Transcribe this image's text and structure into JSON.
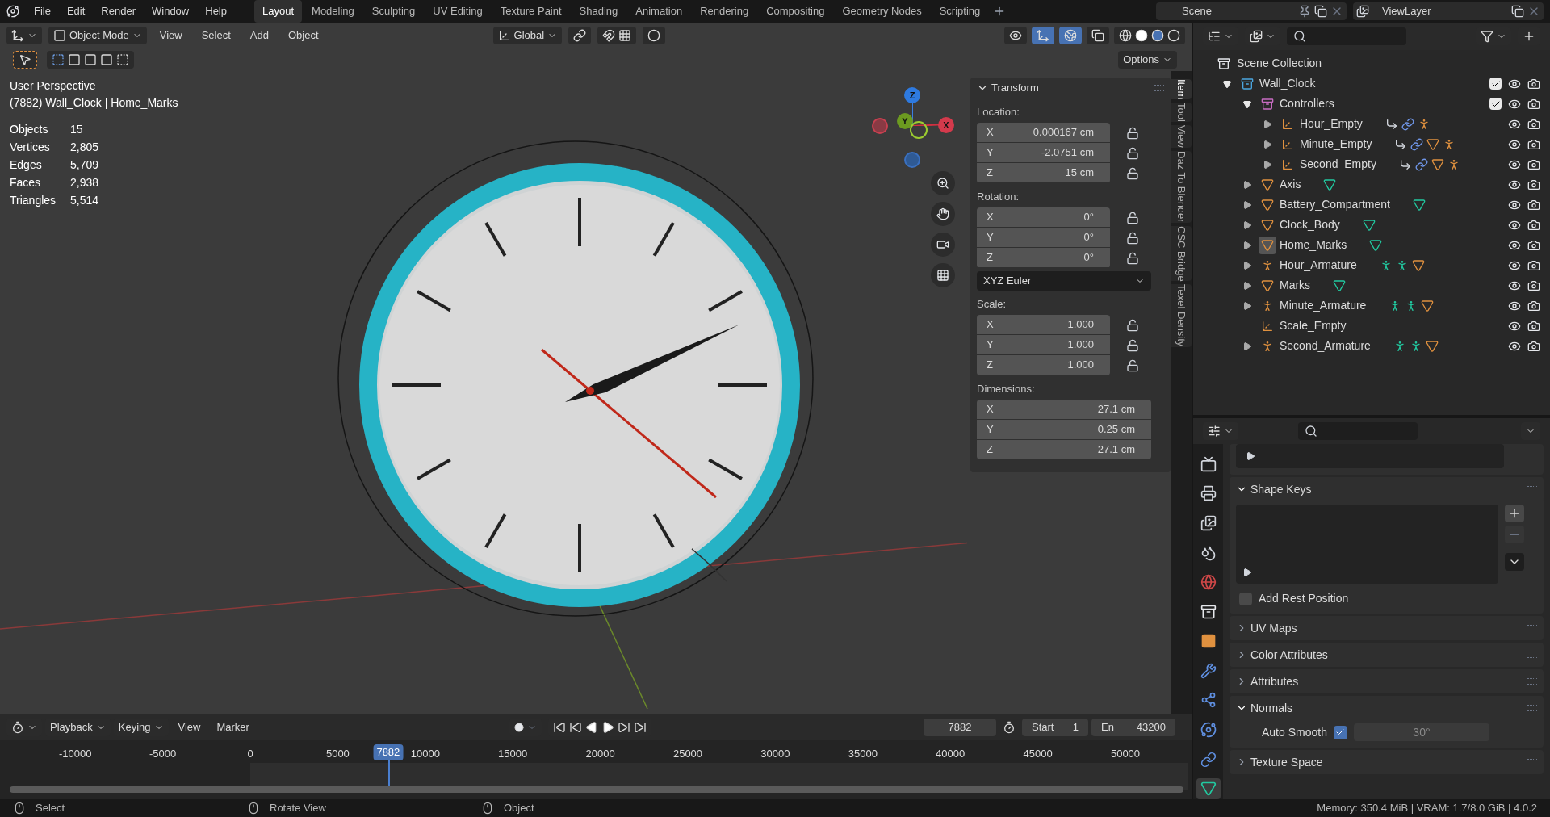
{
  "menu": [
    "File",
    "Edit",
    "Render",
    "Window",
    "Help"
  ],
  "workspaces": [
    {
      "label": "Layout",
      "selected": true
    },
    {
      "label": "Modeling",
      "selected": false
    },
    {
      "label": "Sculpting",
      "selected": false
    },
    {
      "label": "UV Editing",
      "selected": false
    },
    {
      "label": "Texture Paint",
      "selected": false
    },
    {
      "label": "Shading",
      "selected": false
    },
    {
      "label": "Animation",
      "selected": false
    },
    {
      "label": "Rendering",
      "selected": false
    },
    {
      "label": "Compositing",
      "selected": false
    },
    {
      "label": "Geometry Nodes",
      "selected": false
    },
    {
      "label": "Scripting",
      "selected": false
    }
  ],
  "scene": "Scene",
  "view_layer": "ViewLayer",
  "viewport": {
    "mode": "Object Mode",
    "menus": [
      "View",
      "Select",
      "Add",
      "Object"
    ],
    "orientation": "Global",
    "options": "Options",
    "title": "User Perspective",
    "context": "(7882) Wall_Clock | Home_Marks",
    "stats": [
      {
        "label": "Objects",
        "value": "15"
      },
      {
        "label": "Vertices",
        "value": "2,805"
      },
      {
        "label": "Edges",
        "value": "5,709"
      },
      {
        "label": "Faces",
        "value": "2,938"
      },
      {
        "label": "Triangles",
        "value": "5,514"
      }
    ],
    "gizmo": {
      "z": "Z",
      "y": "Y",
      "x": "X"
    }
  },
  "sidebar": {
    "panel": "Transform",
    "groups": [
      {
        "label": "Location:",
        "lockable": true,
        "fields": [
          {
            "axis": "X",
            "value": "0.000167 cm"
          },
          {
            "axis": "Y",
            "value": "-2.0751 cm"
          },
          {
            "axis": "Z",
            "value": "15 cm"
          }
        ]
      },
      {
        "label": "Rotation:",
        "lockable": true,
        "fields": [
          {
            "axis": "X",
            "value": "0°"
          },
          {
            "axis": "Y",
            "value": "0°"
          },
          {
            "axis": "Z",
            "value": "0°"
          }
        ],
        "mode": "XYZ Euler"
      },
      {
        "label": "Scale:",
        "lockable": true,
        "fields": [
          {
            "axis": "X",
            "value": "1.000"
          },
          {
            "axis": "Y",
            "value": "1.000"
          },
          {
            "axis": "Z",
            "value": "1.000"
          }
        ]
      },
      {
        "label": "Dimensions:",
        "lockable": false,
        "fields": [
          {
            "axis": "X",
            "value": "27.1 cm"
          },
          {
            "axis": "Y",
            "value": "0.25 cm"
          },
          {
            "axis": "Z",
            "value": "27.1 cm"
          }
        ]
      }
    ],
    "tabs": [
      {
        "label": "Item",
        "selected": true
      },
      {
        "label": "Tool",
        "selected": false
      },
      {
        "label": "View",
        "selected": false
      },
      {
        "label": "Daz To Blender",
        "selected": false
      },
      {
        "label": "CSC Bridge",
        "selected": false
      },
      {
        "label": "Texel Density",
        "selected": false
      }
    ]
  },
  "timeline": {
    "menus": [
      {
        "label": "Playback",
        "dropdown": true
      },
      {
        "label": "Keying",
        "dropdown": true
      },
      {
        "label": "View",
        "dropdown": false
      },
      {
        "label": "Marker",
        "dropdown": false
      }
    ],
    "frame": "7882",
    "start_label": "Start",
    "start": "1",
    "end_label": "En",
    "end": "43200",
    "playhead": "7882",
    "ruler": [
      "-10000",
      "-5000",
      "0",
      "5000",
      "10000",
      "15000",
      "20000",
      "25000",
      "30000",
      "35000",
      "40000",
      "45000",
      "50000"
    ]
  },
  "outliner": {
    "root": "Scene Collection",
    "tree": [
      {
        "label": "Wall_Clock",
        "kind": "collection",
        "color": "#4ba6e0",
        "checked": true,
        "expanded": true,
        "expandable": true,
        "active": false,
        "children": [
          {
            "label": "Controllers",
            "kind": "collection",
            "color": "#c86cc2",
            "checked": true,
            "expanded": true,
            "expandable": true,
            "active": false,
            "children": [
              {
                "label": "Hour_Empty",
                "kind": "empty",
                "expanded": false,
                "expandable": true,
                "active": false,
                "badges": [
                  {
                    "kind": "parent"
                  },
                  {
                    "kind": "constraint"
                  },
                  {
                    "kind": "armature"
                  }
                ]
              },
              {
                "label": "Minute_Empty",
                "kind": "empty",
                "expanded": false,
                "expandable": true,
                "active": false,
                "badges": [
                  {
                    "kind": "parent"
                  },
                  {
                    "kind": "constraint"
                  },
                  {
                    "kind": "mesh"
                  },
                  {
                    "kind": "armature"
                  }
                ]
              },
              {
                "label": "Second_Empty",
                "kind": "empty",
                "expanded": false,
                "expandable": true,
                "active": false,
                "badges": [
                  {
                    "kind": "parent"
                  },
                  {
                    "kind": "constraint"
                  },
                  {
                    "kind": "mesh"
                  },
                  {
                    "kind": "armature"
                  }
                ]
              }
            ]
          },
          {
            "label": "Axis",
            "kind": "mesh",
            "expanded": false,
            "expandable": true,
            "active": false,
            "badges": [
              {
                "kind": "mesh_data"
              }
            ]
          },
          {
            "label": "Battery_Compartment",
            "kind": "mesh",
            "expanded": false,
            "expandable": true,
            "active": false,
            "badges": [
              {
                "kind": "mesh_data"
              }
            ]
          },
          {
            "label": "Clock_Body",
            "kind": "mesh",
            "expanded": false,
            "expandable": true,
            "active": false,
            "badges": [
              {
                "kind": "mesh_data"
              }
            ]
          },
          {
            "label": "Home_Marks",
            "kind": "mesh",
            "expanded": false,
            "expandable": true,
            "active": true,
            "badges": [
              {
                "kind": "mesh_data"
              }
            ]
          },
          {
            "label": "Hour_Armature",
            "kind": "armature",
            "expanded": false,
            "expandable": true,
            "active": false,
            "badges": [
              {
                "kind": "pose"
              },
              {
                "kind": "bones"
              },
              {
                "kind": "mesh"
              }
            ]
          },
          {
            "label": "Marks",
            "kind": "mesh",
            "expanded": false,
            "expandable": true,
            "active": false,
            "badges": [
              {
                "kind": "mesh_data"
              }
            ]
          },
          {
            "label": "Minute_Armature",
            "kind": "armature",
            "expanded": false,
            "expandable": true,
            "active": false,
            "badges": [
              {
                "kind": "pose"
              },
              {
                "kind": "bones"
              },
              {
                "kind": "mesh"
              }
            ]
          },
          {
            "label": "Scale_Empty",
            "kind": "empty",
            "expandable": false,
            "active": false
          },
          {
            "label": "Second_Armature",
            "kind": "armature",
            "expanded": false,
            "expandable": true,
            "active": false,
            "badges": [
              {
                "kind": "pose"
              },
              {
                "kind": "bones"
              },
              {
                "kind": "mesh"
              }
            ]
          }
        ]
      }
    ]
  },
  "properties": {
    "tabs": [
      {
        "kind": "render",
        "selected": false
      },
      {
        "kind": "output",
        "selected": false
      },
      {
        "kind": "view_layer",
        "selected": false
      },
      {
        "kind": "scene",
        "selected": false
      },
      {
        "kind": "world",
        "selected": false
      },
      {
        "kind": "collection",
        "selected": false
      },
      {
        "kind": "object",
        "selected": false
      },
      {
        "kind": "modifiers",
        "selected": false
      },
      {
        "kind": "particles",
        "selected": false
      },
      {
        "kind": "physics",
        "selected": false
      },
      {
        "kind": "constraints",
        "selected": false
      },
      {
        "kind": "data",
        "selected": true
      }
    ],
    "shape_keys": "Shape Keys",
    "rest_position": {
      "label": "Add Rest Position",
      "checked": false
    },
    "panels": [
      {
        "label": "UV Maps",
        "expanded": false
      },
      {
        "label": "Color Attributes",
        "expanded": false
      },
      {
        "label": "Attributes",
        "expanded": false
      }
    ],
    "normals": {
      "label": "Normals",
      "expanded": true,
      "auto_smooth": {
        "label": "Auto Smooth",
        "checked": true,
        "angle": "30°"
      }
    },
    "texture_space": {
      "label": "Texture Space",
      "expanded": false
    }
  },
  "status_bar": {
    "hints": [
      "Select",
      "Rotate View",
      "Object"
    ],
    "info": "Memory: 350.4 MiB | VRAM: 1.7/8.0 GiB | 4.0.2"
  }
}
